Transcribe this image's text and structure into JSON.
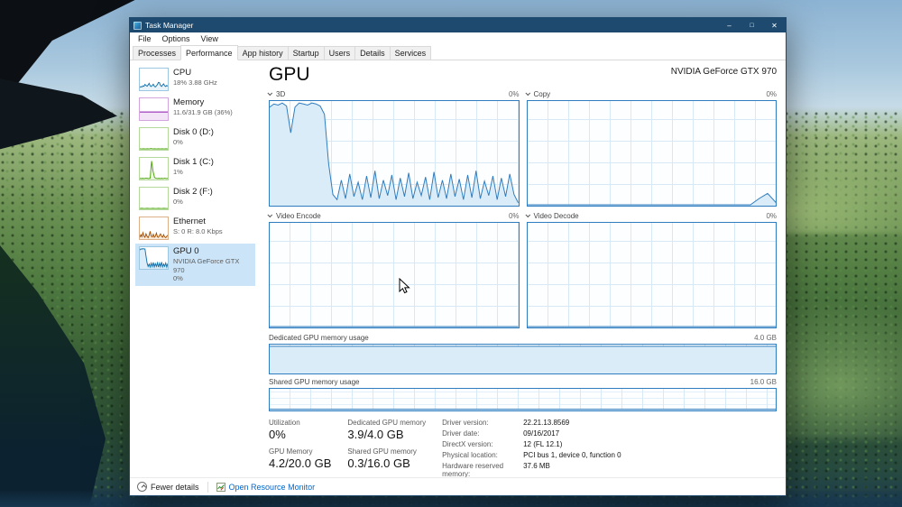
{
  "window": {
    "title": "Task Manager",
    "menus": [
      {
        "label": "File"
      },
      {
        "label": "Options"
      },
      {
        "label": "View"
      }
    ],
    "controls": [
      {
        "id": "minimize",
        "glyph": "–"
      },
      {
        "id": "maximize",
        "glyph": "□"
      },
      {
        "id": "close",
        "glyph": "✕"
      }
    ],
    "tabs": [
      {
        "label": "Processes"
      },
      {
        "label": "Performance",
        "active": true
      },
      {
        "label": "App history"
      },
      {
        "label": "Startup"
      },
      {
        "label": "Users"
      },
      {
        "label": "Details"
      },
      {
        "label": "Services"
      }
    ]
  },
  "sidebar": {
    "items": [
      {
        "id": "cpu",
        "title": "CPU",
        "lines": [
          "18% 3.88 GHz"
        ],
        "color": "#1170aa",
        "border": "#9dc6e0",
        "fill": "#e8f3fa",
        "spark": [
          10,
          14,
          12,
          18,
          15,
          25,
          20,
          16,
          22,
          30,
          18,
          14,
          20,
          26,
          16,
          12,
          18,
          24,
          35,
          33,
          20,
          15,
          22,
          28,
          18,
          14,
          20,
          16
        ]
      },
      {
        "id": "memory",
        "title": "Memory",
        "lines": [
          "11.6/31.9 GB (36%)"
        ],
        "color": "#8b12ae",
        "border": "#d2a5de",
        "fill": "#f3e3f7",
        "spark": [
          36,
          36,
          36,
          36,
          36,
          36,
          36,
          36,
          36,
          36,
          36,
          36
        ]
      },
      {
        "id": "disk0",
        "title": "Disk 0 (D:)",
        "lines": [
          "0%"
        ],
        "color": "#4da60d",
        "border": "#b5d99c",
        "fill": "#ecf6e3",
        "spark": [
          1,
          0,
          1,
          0,
          1,
          0,
          2,
          0,
          1,
          0,
          1,
          0,
          1,
          0,
          1,
          0
        ]
      },
      {
        "id": "disk1",
        "title": "Disk 1 (C:)",
        "lines": [
          "1%"
        ],
        "color": "#4da60d",
        "border": "#b5d99c",
        "fill": "#ecf6e3",
        "spark": [
          2,
          1,
          2,
          1,
          3,
          2,
          1,
          2,
          88,
          38,
          6,
          2,
          1,
          2,
          1,
          2,
          1,
          3,
          1,
          2
        ]
      },
      {
        "id": "disk2",
        "title": "Disk 2 (F:)",
        "lines": [
          "0%"
        ],
        "color": "#4da60d",
        "border": "#b5d99c",
        "fill": "#ecf6e3",
        "spark": [
          0,
          1,
          0,
          0,
          1,
          0,
          0,
          1,
          0,
          0,
          1,
          0,
          0,
          1,
          0,
          0
        ]
      },
      {
        "id": "ethernet",
        "title": "Ethernet",
        "lines": [
          "S: 0  R: 8.0 Kbps"
        ],
        "color": "#a74f01",
        "border": "#dcb18a",
        "fill": "#f8ead9",
        "spark": [
          4,
          18,
          8,
          28,
          10,
          5,
          22,
          9,
          3,
          15,
          35,
          12,
          6,
          20,
          5,
          10,
          26,
          7,
          4,
          14,
          22,
          9,
          5,
          18,
          7,
          3,
          10,
          15
        ]
      },
      {
        "id": "gpu0",
        "title": "GPU 0",
        "lines": [
          "NVIDIA GeForce GTX 970",
          "0%"
        ],
        "color": "#1170aa",
        "border": "#9dc6e0",
        "fill": "#dcedf9",
        "selected": true,
        "spark": [
          90,
          96,
          94,
          97,
          95,
          96,
          60,
          25,
          8,
          20,
          5,
          24,
          7,
          28,
          6,
          22,
          8,
          26,
          5,
          24,
          7,
          30,
          6,
          20,
          8,
          25,
          5,
          22
        ]
      }
    ]
  },
  "gpu": {
    "heading": "GPU",
    "device_name": "NVIDIA GeForce GTX 970",
    "engine_charts": [
      {
        "label": "3D",
        "value": "0%",
        "series": [
          95,
          98,
          97,
          99,
          96,
          70,
          95,
          99,
          98,
          97,
          99,
          98,
          96,
          88,
          40,
          10,
          5,
          24,
          6,
          30,
          8,
          22,
          5,
          28,
          7,
          33,
          6,
          24,
          9,
          29,
          5,
          26,
          8,
          31,
          6,
          22,
          9,
          27,
          5,
          32,
          7,
          24,
          6,
          30,
          8,
          25,
          5,
          29,
          7,
          33,
          6,
          23,
          9,
          28,
          5,
          26,
          8,
          30,
          10,
          2
        ]
      },
      {
        "label": "Copy",
        "value": "0%",
        "series": [
          0,
          0,
          0,
          0,
          0,
          0,
          0,
          0,
          0,
          0,
          0,
          0,
          0,
          0,
          0,
          0,
          0,
          0,
          0,
          0,
          0,
          0,
          0,
          0,
          0,
          0,
          0,
          6,
          11,
          2
        ]
      },
      {
        "label": "Video Encode",
        "value": "0%",
        "series": [
          0,
          0
        ]
      },
      {
        "label": "Video Decode",
        "value": "0%",
        "series": [
          0,
          0
        ]
      }
    ],
    "memory_charts": [
      {
        "label": "Dedicated GPU memory usage",
        "value": "4.0 GB",
        "series": [
          97,
          97
        ]
      },
      {
        "label": "Shared GPU memory usage",
        "value": "16.0 GB",
        "series": [
          2,
          2
        ]
      }
    ],
    "stats_big": [
      [
        {
          "label": "Utilization",
          "value": "0%"
        },
        {
          "label": "GPU Memory",
          "value": "4.2/20.0 GB"
        }
      ],
      [
        {
          "label": "Dedicated GPU memory",
          "value": "3.9/4.0 GB"
        },
        {
          "label": "Shared GPU memory",
          "value": "0.3/16.0 GB"
        }
      ]
    ],
    "stats_small": [
      {
        "label": "Driver version:",
        "value": "22.21.13.8569"
      },
      {
        "label": "Driver date:",
        "value": "09/16/2017"
      },
      {
        "label": "DirectX version:",
        "value": "12 (FL 12.1)"
      },
      {
        "label": "Physical location:",
        "value": "PCI bus 1, device 0, function 0"
      },
      {
        "label": "Hardware reserved memory:",
        "value": "37.6 MB"
      }
    ]
  },
  "footer": {
    "fewer_details": "Fewer details",
    "open_resource_monitor": "Open Resource Monitor"
  },
  "colors": {
    "titlebar": "#1d4a6e",
    "chart_line": "#2f7cbe",
    "chart_fill": "#d9ecf8",
    "selected_item_bg": "#cbe4f7",
    "link": "#0066cc"
  }
}
